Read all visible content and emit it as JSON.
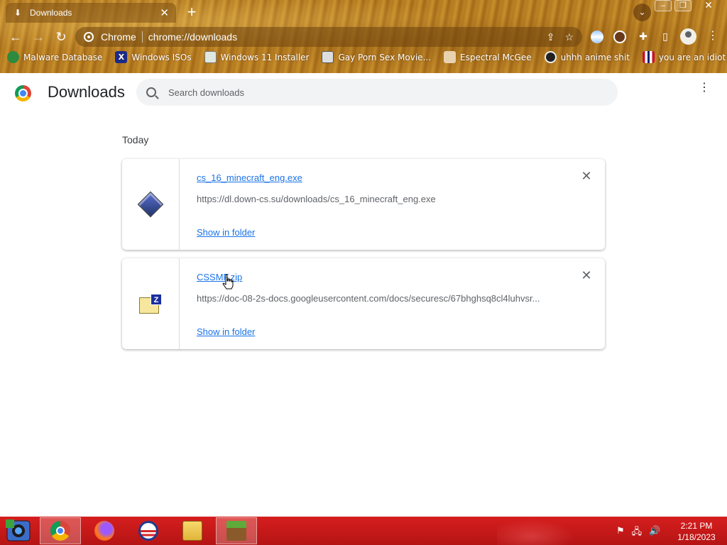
{
  "window": {
    "tab_title": "Downloads",
    "new_tab_label": "+",
    "omnibox_site": "Chrome",
    "omnibox_url": "chrome://downloads"
  },
  "bookmarks": [
    {
      "label": "Malware Database",
      "icon": "malware-icon"
    },
    {
      "label": "Windows ISOs",
      "icon": "x-logo-icon"
    },
    {
      "label": "Windows 11 Installer",
      "icon": "image-icon"
    },
    {
      "label": "Gay Porn Sex Movie...",
      "icon": "avatar-icon"
    },
    {
      "label": "Espectral McGee",
      "icon": "avatar-icon"
    },
    {
      "label": "uhhh anime shit",
      "icon": "anime-icon"
    },
    {
      "label": "you are an idiot!",
      "icon": "flag-icon"
    }
  ],
  "page": {
    "title": "Downloads",
    "search_placeholder": "Search downloads",
    "section_label": "Today"
  },
  "downloads": [
    {
      "filename": "cs_16_minecraft_eng.exe",
      "url": "https://dl.down-cs.su/downloads/cs_16_minecraft_eng.exe",
      "action": "Show in folder",
      "icon": "exe-icon"
    },
    {
      "filename": "CSSMF.zip",
      "url": "https://doc-08-2s-docs.googleusercontent.com/docs/securesc/67bhghsq8cl4luhvsr...",
      "action": "Show in folder",
      "icon": "zip-icon"
    }
  ],
  "taskbar": {
    "apps": [
      "chrome",
      "firefox",
      "obama-icon",
      "explorer",
      "minecraft"
    ],
    "time": "2:21 PM",
    "date": "1/18/2023"
  },
  "colors": {
    "link": "#1a73e8",
    "taskbar": "#c81a1a",
    "theme": "#b57f24"
  }
}
